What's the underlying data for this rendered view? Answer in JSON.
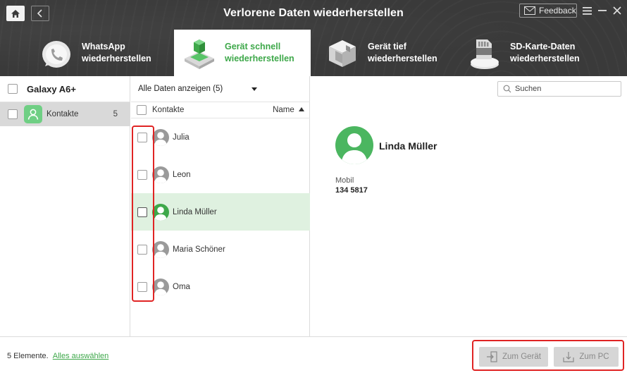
{
  "window": {
    "title": "Verlorene Daten wiederherstellen",
    "feedback_label": "Feedback"
  },
  "tabs": [
    {
      "label_line1": "WhatsApp",
      "label_line2": "wiederherstellen",
      "active": false,
      "icon": "whatsapp-icon"
    },
    {
      "label_line1": "Gerät schnell",
      "label_line2": "wiederherstellen",
      "active": true,
      "icon": "quick-recover-icon"
    },
    {
      "label_line1": "Gerät tief",
      "label_line2": "wiederherstellen",
      "active": false,
      "icon": "deep-recover-icon"
    },
    {
      "label_line1": "SD-Karte-Daten",
      "label_line2": "wiederherstellen",
      "active": false,
      "icon": "sd-card-icon"
    }
  ],
  "sidebar": {
    "device_name": "Galaxy A6+",
    "categories": [
      {
        "label": "Kontakte",
        "count": "5",
        "icon": "contacts-icon"
      }
    ]
  },
  "filter": {
    "selected": "Alle Daten anzeigen (5)"
  },
  "search": {
    "placeholder": "Suchen"
  },
  "list": {
    "column_label": "Kontakte",
    "sort_label": "Name",
    "rows": [
      {
        "name": "Julia",
        "selected": false
      },
      {
        "name": "Leon",
        "selected": false
      },
      {
        "name": "Linda Müller",
        "selected": true
      },
      {
        "name": "Maria Schöner",
        "selected": false
      },
      {
        "name": "Oma",
        "selected": false
      }
    ]
  },
  "detail": {
    "name": "Linda Müller",
    "field_label": "Mobil",
    "field_value": "134 5817"
  },
  "footer": {
    "count_text": "5 Elemente.",
    "select_all": "Alles auswählen",
    "to_device": "Zum Gerät",
    "to_pc": "Zum PC"
  },
  "colors": {
    "accent": "#3ea84a",
    "header_bg": "#3a3a3a",
    "highlight": "#e02424",
    "selected_row": "#dff1e0"
  }
}
